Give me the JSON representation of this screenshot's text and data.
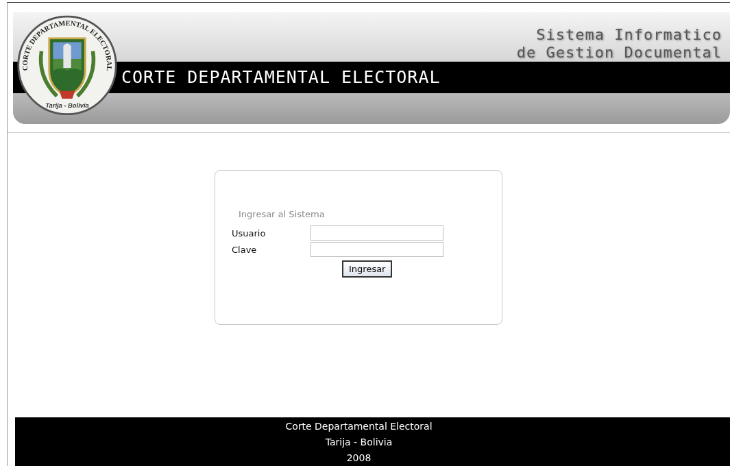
{
  "header": {
    "seal": {
      "ring_text": "CORTE DEPARTAMENTAL ELECTORAL",
      "motto": "Tarija - Bolivia"
    },
    "title": "CORTE DEPARTAMENTAL ELECTORAL",
    "system_name": [
      "Sistema Informatico",
      "de Gestion Documental"
    ]
  },
  "login": {
    "heading": "Ingresar al Sistema",
    "fields": [
      {
        "label": "Usuario"
      },
      {
        "label": "Clave"
      }
    ],
    "submit": "Ingresar"
  },
  "footer": [
    "Corte Departamental Electoral",
    "Tarija - Bolivia",
    "2008"
  ]
}
